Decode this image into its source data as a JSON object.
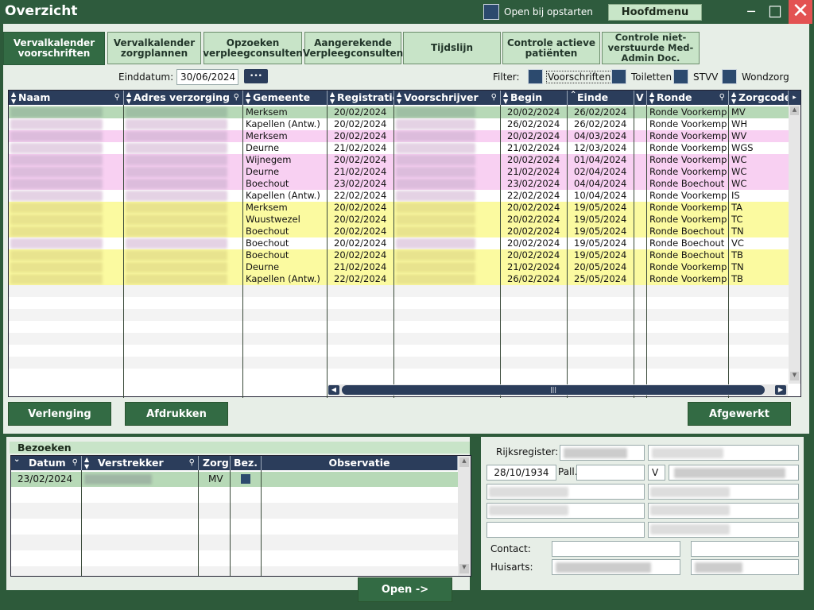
{
  "window": {
    "title": "Overzicht",
    "open_on_start_label": "Open bij opstarten",
    "main_menu_label": "Hoofdmenu"
  },
  "tabs": [
    {
      "label": "Vervalkalender voorschriften",
      "active": true
    },
    {
      "label": "Vervalkalender zorgplannen"
    },
    {
      "label": "Opzoeken verpleegconsulten"
    },
    {
      "label": "Aangerekende Verpleegconsulten"
    },
    {
      "label": "Tijdslijn"
    },
    {
      "label": "Controle actieve patiënten"
    },
    {
      "label": "Controle niet-verstuurde Med-Admin Doc."
    }
  ],
  "toolbar": {
    "end_date_label": "Einddatum:",
    "end_date_value": "30/06/2024",
    "dots_label": "•••",
    "filter_label": "Filter:",
    "filters": [
      "Voorschriften",
      "Toiletten",
      "STVV",
      "Wondzorg"
    ]
  },
  "grid": {
    "columns": [
      "Naam",
      "Adres verzorging",
      "Gemeente",
      "Registratie",
      "Voorschrijver",
      "Begin",
      "Einde",
      "V",
      "Ronde",
      "Zorgcode"
    ],
    "rows": [
      {
        "gemeente": "Merksem",
        "registratie": "20/02/2024",
        "begin": "20/02/2024",
        "einde": "26/02/2024",
        "ronde": "Ronde Voorkemp",
        "zorgcode": "MV",
        "color": "#b7d9b7"
      },
      {
        "gemeente": "Kapellen (Antw.)",
        "registratie": "20/02/2024",
        "begin": "26/02/2024",
        "einde": "26/02/2024",
        "ronde": "Ronde Voorkemp",
        "zorgcode": "WH",
        "color": "#ffffff"
      },
      {
        "gemeente": "Merksem",
        "registratie": "20/02/2024",
        "begin": "20/02/2024",
        "einde": "04/03/2024",
        "ronde": "Ronde Voorkemp",
        "zorgcode": "WV",
        "color": "#f8d0f2"
      },
      {
        "gemeente": "Deurne",
        "registratie": "21/02/2024",
        "begin": "21/02/2024",
        "einde": "12/03/2024",
        "ronde": "Ronde Voorkemp",
        "zorgcode": "WGS",
        "color": "#ffffff"
      },
      {
        "gemeente": "Wijnegem",
        "registratie": "20/02/2024",
        "begin": "20/02/2024",
        "einde": "01/04/2024",
        "ronde": "Ronde Voorkemp",
        "zorgcode": "WC",
        "color": "#f8d0f2"
      },
      {
        "gemeente": "Deurne",
        "registratie": "21/02/2024",
        "begin": "21/02/2024",
        "einde": "02/04/2024",
        "ronde": "Ronde Voorkemp",
        "zorgcode": "WC",
        "color": "#f8d0f2"
      },
      {
        "gemeente": "Boechout",
        "registratie": "23/02/2024",
        "begin": "23/02/2024",
        "einde": "04/04/2024",
        "ronde": "Ronde Boechout '",
        "zorgcode": "WC",
        "color": "#f8d0f2"
      },
      {
        "gemeente": "Kapellen (Antw.)",
        "registratie": "22/02/2024",
        "begin": "22/02/2024",
        "einde": "10/04/2024",
        "ronde": "Ronde Voorkemp",
        "zorgcode": "IS",
        "color": "#ffffff"
      },
      {
        "gemeente": "Merksem",
        "registratie": "20/02/2024",
        "begin": "20/02/2024",
        "einde": "19/05/2024",
        "ronde": "Ronde Voorkemp",
        "zorgcode": "TA",
        "color": "#fbfaa0"
      },
      {
        "gemeente": "Wuustwezel",
        "registratie": "20/02/2024",
        "begin": "20/02/2024",
        "einde": "19/05/2024",
        "ronde": "Ronde Voorkemp",
        "zorgcode": "TC",
        "color": "#fbfaa0"
      },
      {
        "gemeente": "Boechout",
        "registratie": "20/02/2024",
        "begin": "20/02/2024",
        "einde": "19/05/2024",
        "ronde": "Ronde Boechout '",
        "zorgcode": "TN",
        "color": "#fbfaa0"
      },
      {
        "gemeente": "Boechout",
        "registratie": "20/02/2024",
        "begin": "20/02/2024",
        "einde": "19/05/2024",
        "ronde": "Ronde Boechout I",
        "zorgcode": "VC",
        "color": "#ffffff"
      },
      {
        "gemeente": "Boechout",
        "registratie": "20/02/2024",
        "begin": "20/02/2024",
        "einde": "19/05/2024",
        "ronde": "Ronde Boechout I",
        "zorgcode": "TB",
        "color": "#fbfaa0"
      },
      {
        "gemeente": "Deurne",
        "registratie": "21/02/2024",
        "begin": "21/02/2024",
        "einde": "20/05/2024",
        "ronde": "Ronde Voorkemp",
        "zorgcode": "TN",
        "color": "#fbfaa0"
      },
      {
        "gemeente": "Kapellen (Antw.)",
        "registratie": "22/02/2024",
        "begin": "26/02/2024",
        "einde": "25/05/2024",
        "ronde": "Ronde Voorkemp",
        "zorgcode": "TB",
        "color": "#fbfaa0"
      }
    ]
  },
  "buttons": {
    "verlenging": "Verlenging",
    "afdrukken": "Afdrukken",
    "afgewerkt": "Afgewerkt",
    "open": "Open ->"
  },
  "bezoeken": {
    "title": "Bezoeken",
    "columns": [
      "Datum",
      "Verstrekker",
      "Zorg",
      "Bez.",
      "Observatie"
    ],
    "row": {
      "datum": "23/02/2024",
      "zorg": "MV"
    }
  },
  "details": {
    "rijksregister_label": "Rijksregister:",
    "birth_date": "28/10/1934",
    "pall_label": "Pall.",
    "gender": "V",
    "contact_label": "Contact:",
    "huisarts_label": "Huisarts:"
  }
}
